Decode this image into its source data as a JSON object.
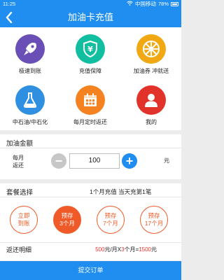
{
  "status_bar": {
    "time": "11:25",
    "carrier": "中国移动",
    "battery": "78%"
  },
  "header": {
    "back_icon": "chevron-left-icon",
    "title": "加油卡充值"
  },
  "features": [
    {
      "label": "极速到账",
      "icon": "rocket-icon",
      "color": "#6a4fb6"
    },
    {
      "label": "充值保障",
      "icon": "shield-yen-icon",
      "color": "#11bfa0"
    },
    {
      "label": "加油券 冲就送",
      "icon": "wheel-icon",
      "color": "#f0a813"
    },
    {
      "label": "中石油/中石化",
      "icon": "flask-icon",
      "color": "#2f8fe0"
    },
    {
      "label": "每月定时返还",
      "icon": "calendar-icon",
      "color": "#f58220"
    },
    {
      "label": "我的",
      "icon": "user-icon",
      "color": "#e2332a"
    }
  ],
  "amount_section": {
    "title": "加油金额",
    "monthly_label_line1": "每月",
    "monthly_label_line2": "返还",
    "minus": "−",
    "plus": "+",
    "value": "100",
    "unit": "元"
  },
  "plan_section": {
    "title": "套餐选择",
    "info": "1个月充值  当天充第1笔",
    "packages": [
      {
        "line1": "立即",
        "line2": "到账",
        "active": false
      },
      {
        "line1": "预存",
        "line2": "3个月",
        "active": true
      },
      {
        "line1": "预存",
        "line2": "7个月",
        "active": false
      },
      {
        "line1": "预存",
        "line2": "17个月",
        "active": false
      }
    ],
    "detail_label": "返还明细",
    "formula": {
      "monthly": "500",
      "unit1": "元/月X",
      "months": "3",
      "unit2": "个月=",
      "total": "1500",
      "unit3": "元"
    }
  },
  "submit_label": "提交订单"
}
